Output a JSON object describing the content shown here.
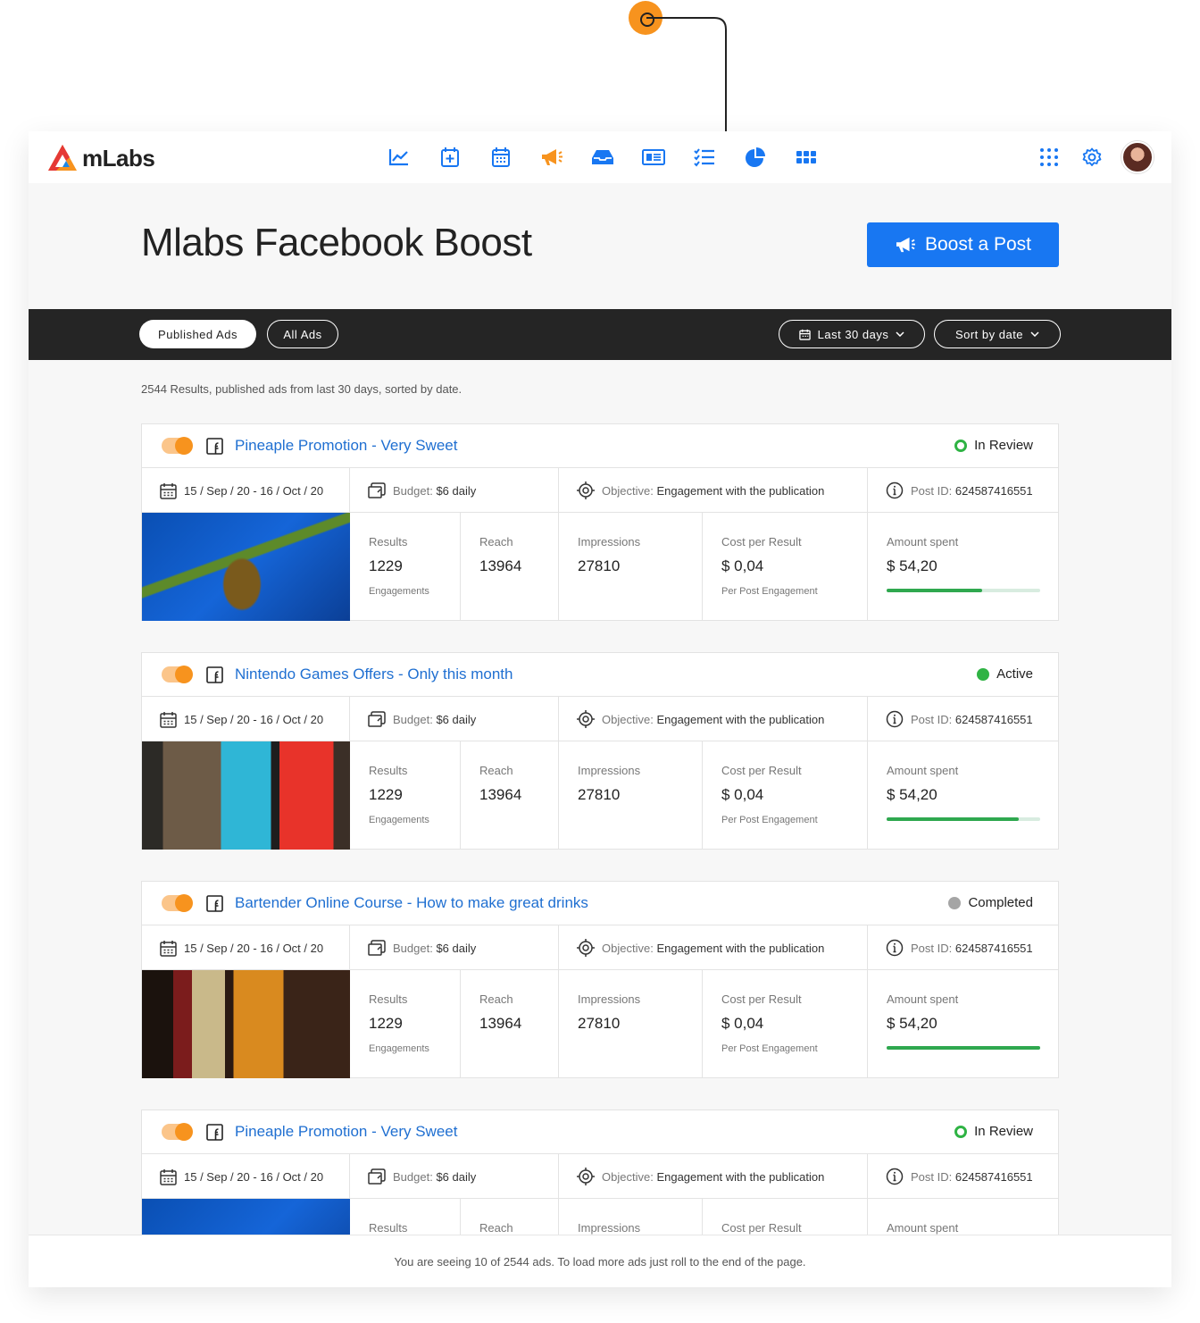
{
  "app": {
    "logo_text": "mLabs"
  },
  "nav": {
    "icons": [
      "analytics-icon",
      "calendar-add-icon",
      "calendar-icon",
      "megaphone-icon",
      "inbox-icon",
      "report-icon",
      "checklist-icon",
      "pie-chart-icon",
      "grid-icon"
    ],
    "accent": "#1877f2",
    "active_accent": "#f7931e"
  },
  "header": {
    "title": "Mlabs Facebook Boost",
    "boost_button": "Boost a Post"
  },
  "filters": {
    "published_ads": "Published Ads",
    "all_ads": "All Ads",
    "date_range": "Last 30 days",
    "sort": "Sort by date"
  },
  "results_summary": "2544 Results, published ads from last 30 days, sorted by date.",
  "labels": {
    "budget": "Budget:",
    "objective": "Objective:",
    "post_id": "Post ID:",
    "results": "Results",
    "reach": "Reach",
    "impressions": "Impressions",
    "cost_per_result": "Cost per Result",
    "amount_spent": "Amount spent",
    "engagements": "Engagements",
    "per_post_engagement": "Per Post Engagement"
  },
  "ads": [
    {
      "title": "Pineaple Promotion - Very Sweet",
      "status": "In Review",
      "dates": "15 / Sep / 20 - 16 / Oct / 20",
      "budget": "$6 daily",
      "objective": "Engagement with the publication",
      "post_id": "624587416551",
      "results": "1229",
      "reach": "13964",
      "impressions": "27810",
      "cost_per_result": "$ 0,04",
      "amount_spent": "$ 54,20",
      "spent_progress": 0.62
    },
    {
      "title": "Nintendo Games Offers - Only this month",
      "status": "Active",
      "dates": "15 / Sep / 20 - 16 / Oct / 20",
      "budget": "$6 daily",
      "objective": "Engagement with the publication",
      "post_id": "624587416551",
      "results": "1229",
      "reach": "13964",
      "impressions": "27810",
      "cost_per_result": "$ 0,04",
      "amount_spent": "$ 54,20",
      "spent_progress": 0.86
    },
    {
      "title": "Bartender Online Course - How to make great drinks",
      "status": "Completed",
      "dates": "15 / Sep / 20 - 16 / Oct / 20",
      "budget": "$6 daily",
      "objective": "Engagement with the publication",
      "post_id": "624587416551",
      "results": "1229",
      "reach": "13964",
      "impressions": "27810",
      "cost_per_result": "$ 0,04",
      "amount_spent": "$ 54,20",
      "spent_progress": 1.0
    },
    {
      "title": "Pineaple Promotion - Very Sweet",
      "status": "In Review",
      "dates": "15 / Sep / 20 - 16 / Oct / 20",
      "budget": "$6 daily",
      "objective": "Engagement with the publication",
      "post_id": "624587416551"
    }
  ],
  "footer": "You are seeing 10 of 2544 ads. To load more ads just roll to the end of the page."
}
